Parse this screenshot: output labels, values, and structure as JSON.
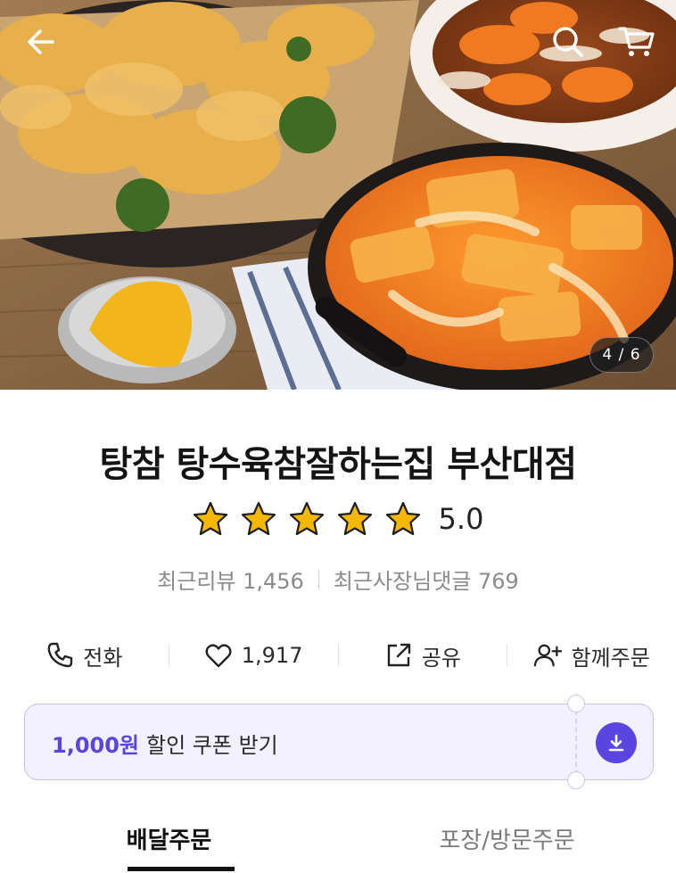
{
  "hero": {
    "photo_counter": "4 / 6",
    "icons": {
      "back": "arrow-left-icon",
      "search": "search-icon",
      "cart": "cart-icon",
      "assist": "assistive-touch-icon"
    }
  },
  "store": {
    "name": "탕참 탕수육참잘하는집 부산대점",
    "rating_value": "5.0",
    "stars": 5,
    "recent_reviews_label": "최근리뷰 1,456",
    "owner_replies_label": "최근사장님댓글 769"
  },
  "actions": {
    "call_label": "전화",
    "favorite_count": "1,917",
    "share_label": "공유",
    "group_order_label": "함께주문"
  },
  "coupon": {
    "amount": "1,000원",
    "text": "할인 쿠폰 받기"
  },
  "tabs": {
    "delivery": "배달주문",
    "pickup": "포장/방문주문"
  },
  "colors": {
    "accent": "#5b45e0",
    "coupon_bg": "#f3f1ff",
    "star": "#f5b800"
  }
}
